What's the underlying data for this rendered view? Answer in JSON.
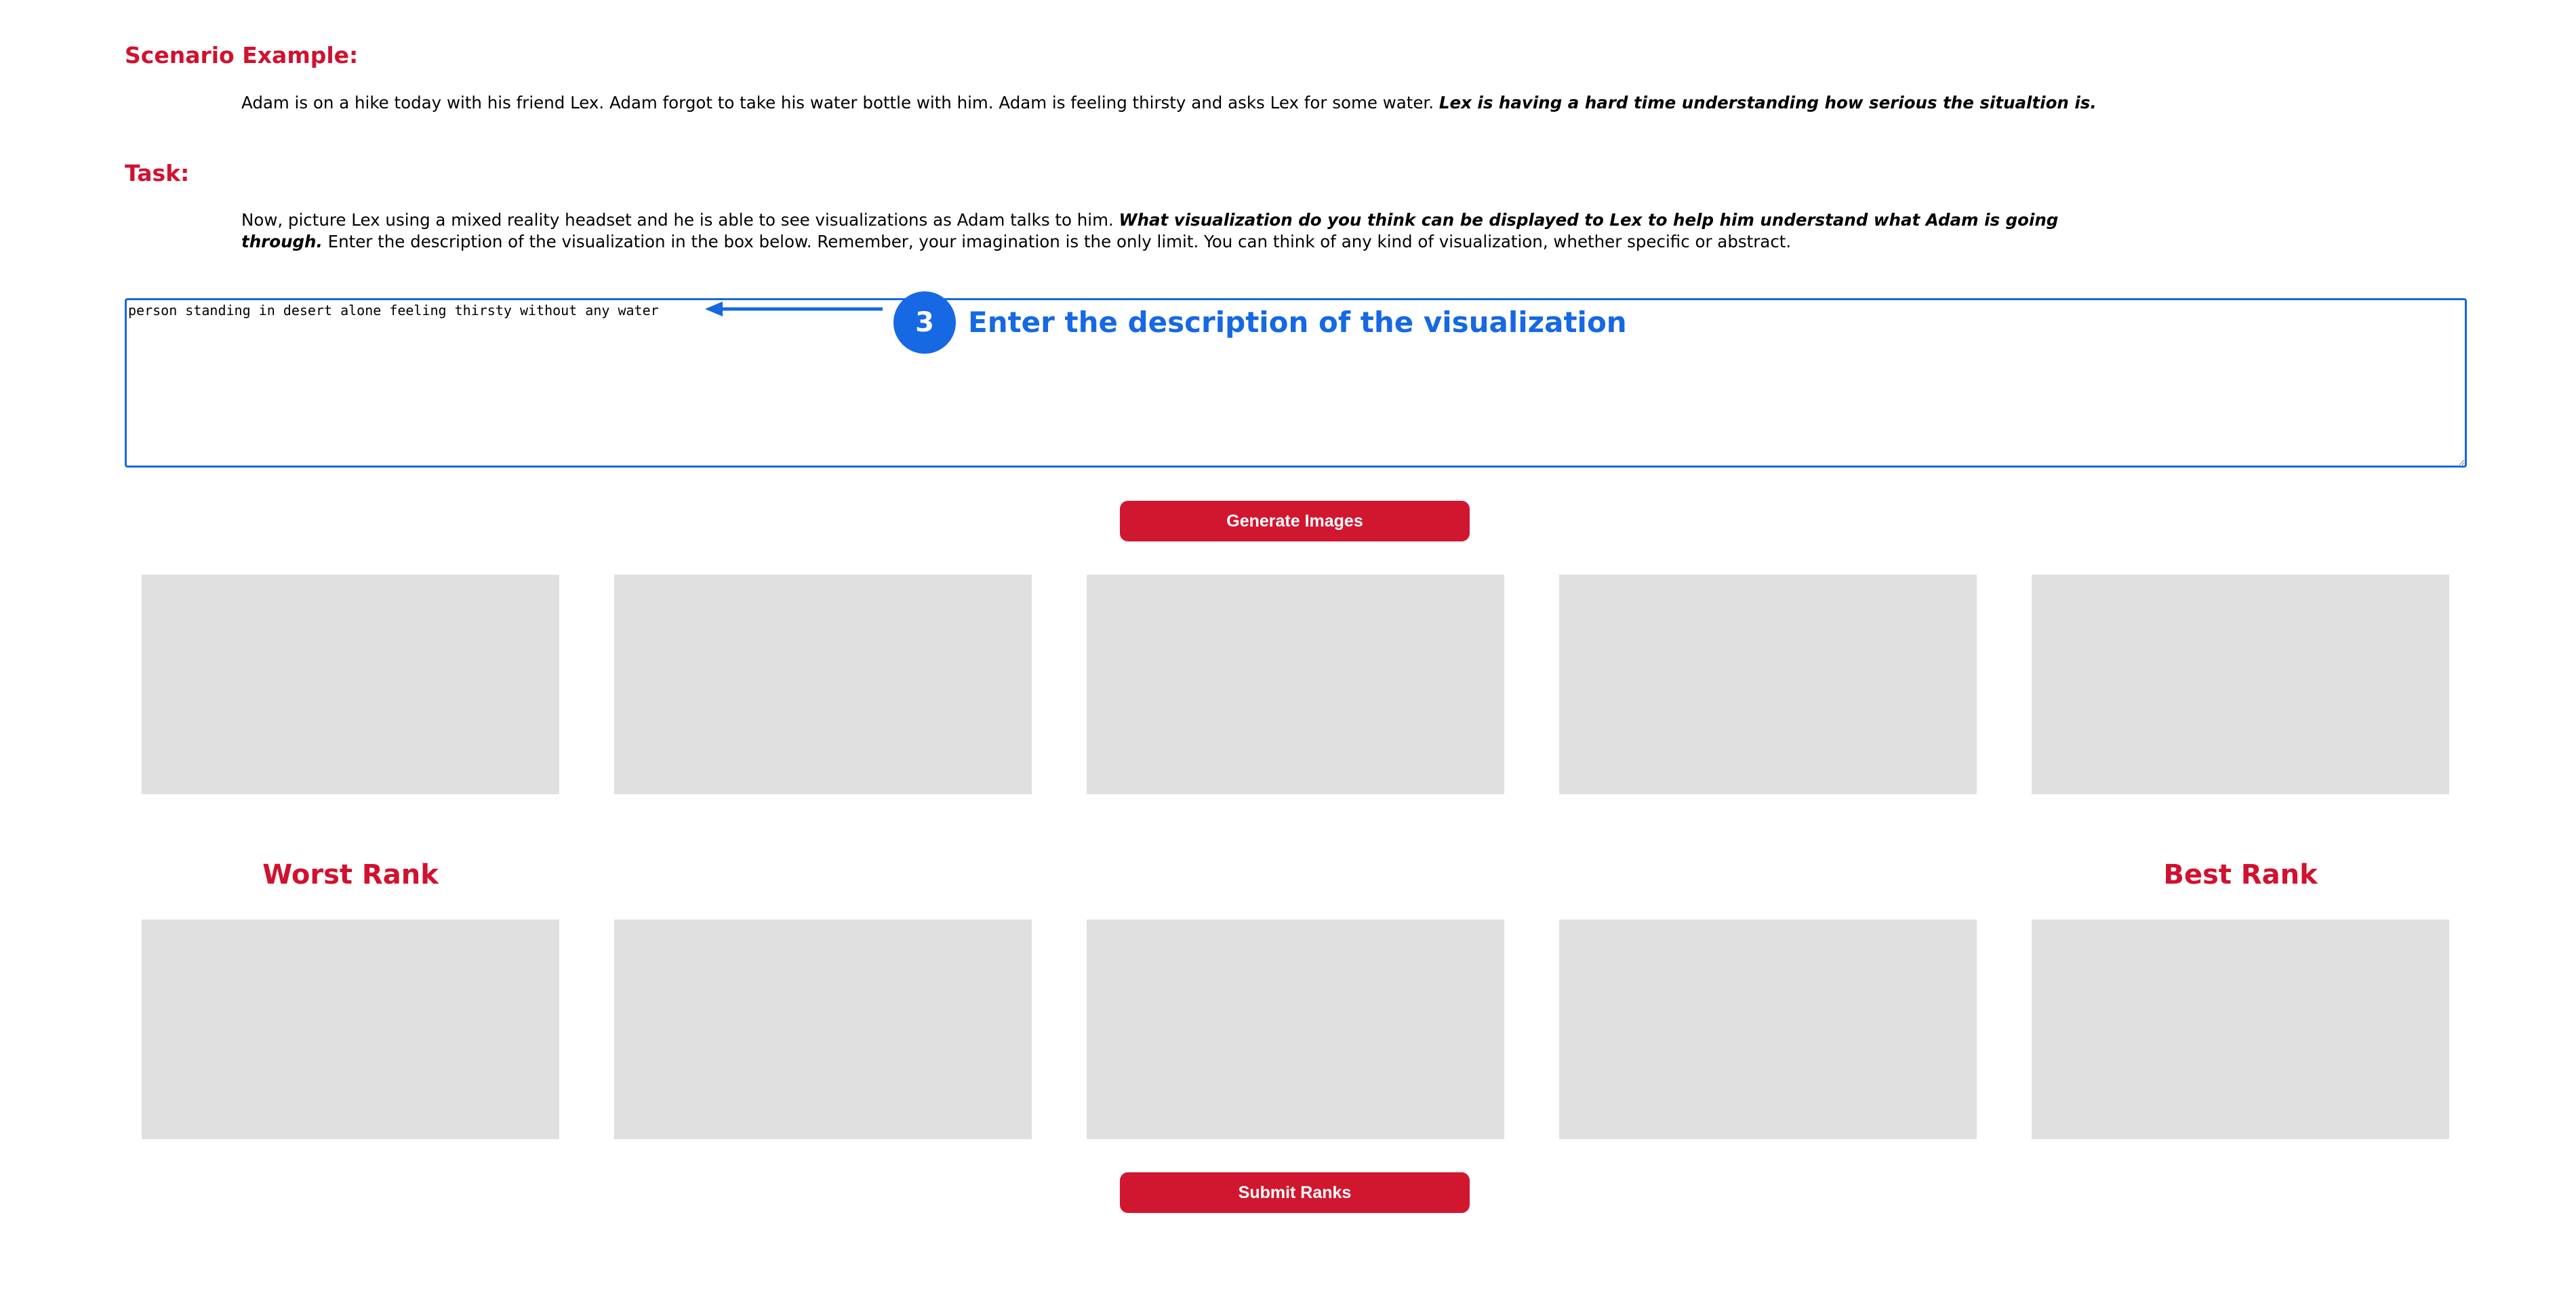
{
  "scenario": {
    "heading": "Scenario Example:",
    "text_plain": "Adam is on a hike today with his friend Lex. Adam forgot to take his water bottle with him. Adam is feeling thirsty and asks Lex for some water.",
    "text_emphasis": "Lex is having a hard time understanding how serious the situaltion is."
  },
  "task": {
    "heading": "Task:",
    "text_plain_1": "Now, picture Lex using a mixed reality headset and he is able to see visualizations as Adam talks to him.",
    "text_emphasis": "What visualization do you think can be displayed to Lex to help him understand what Adam is going through.",
    "text_plain_2": "Enter the description of the visualization in the box below. Remember, your imagination is the only limit. You can think of any kind of visualization, whether specific or abstract."
  },
  "description_input": {
    "value": "person standing in desert alone feeling thirsty without any water"
  },
  "annotation": {
    "step_number": "3",
    "label": "Enter the description of the visualization",
    "color": "#1668e3"
  },
  "buttons": {
    "generate_label": "Generate Images",
    "submit_label": "Submit Ranks"
  },
  "ranking": {
    "worst_label": "Worst Rank",
    "best_label": "Best Rank"
  },
  "colors": {
    "accent_red": "#d0122f",
    "placeholder_gray": "#e0e0e0"
  }
}
